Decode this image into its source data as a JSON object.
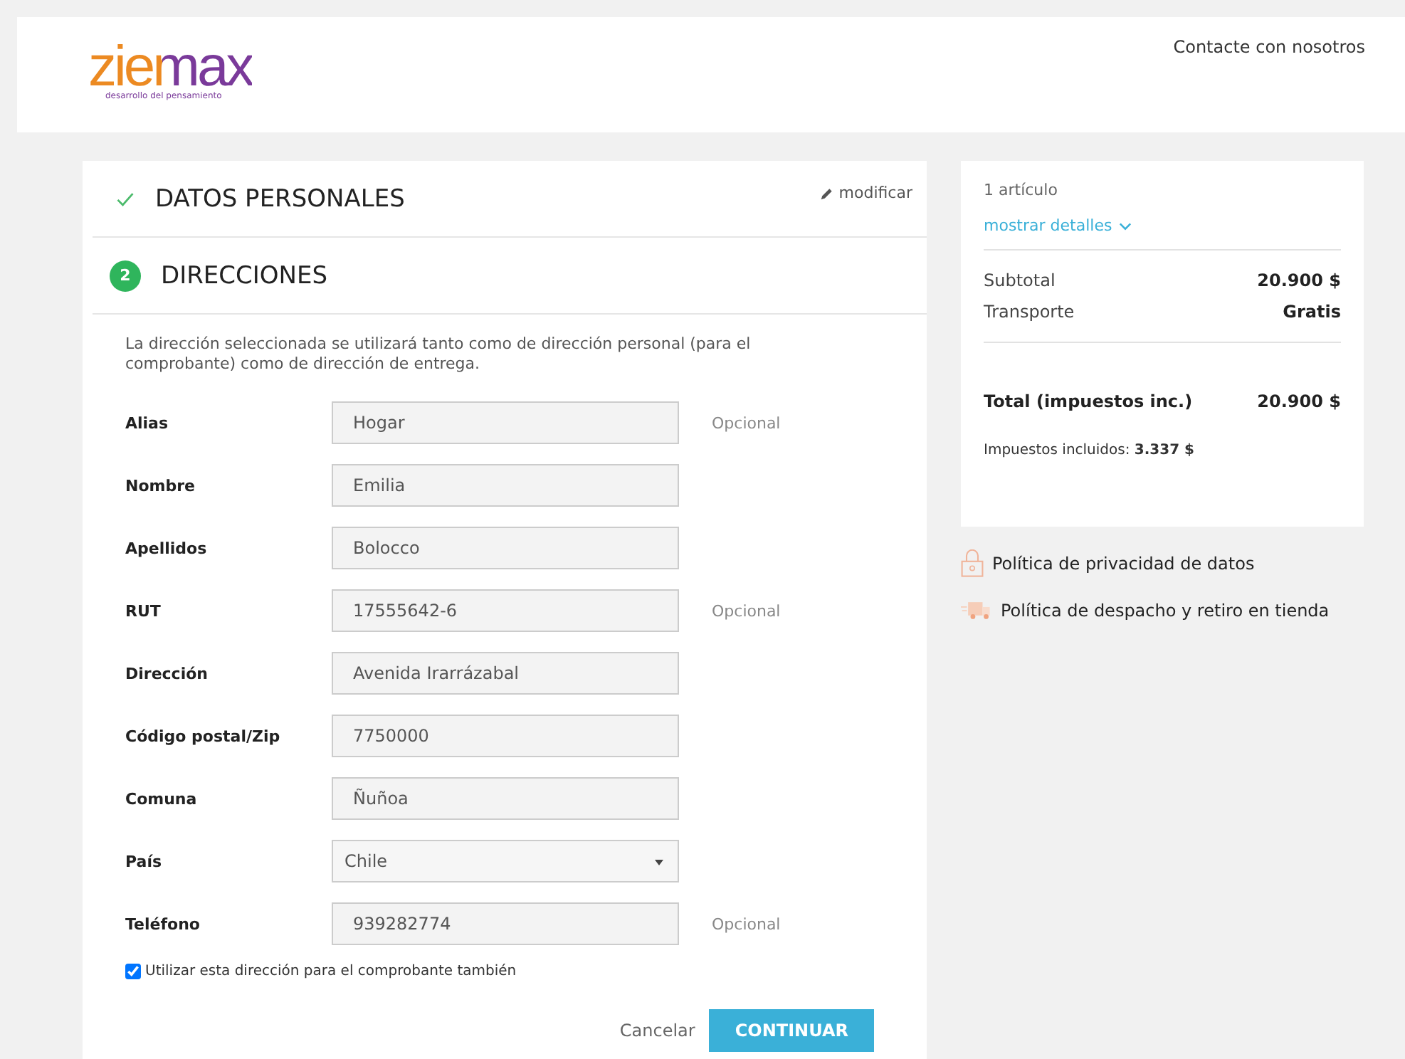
{
  "header": {
    "logo": {
      "wordmark": "ziemax",
      "tagline": "desarrollo del pensamiento"
    },
    "contact_link": "Contacte con nosotros"
  },
  "steps": [
    {
      "kind": "done",
      "title": "DATOS PERSONALES",
      "edit_link": "modificar"
    },
    {
      "kind": "current",
      "number": "2",
      "title": "DIRECCIONES"
    }
  ],
  "address_form": {
    "intro": "La dirección seleccionada se utilizará tanto como de dirección personal (para el comprobante) como de dirección de entrega.",
    "fields": [
      {
        "label": "Alias",
        "kind": "text",
        "value": "Hogar",
        "note": "Opcional"
      },
      {
        "label": "Nombre",
        "kind": "text",
        "value": "Emilia"
      },
      {
        "label": "Apellidos",
        "kind": "text",
        "value": "Bolocco"
      },
      {
        "label": "RUT",
        "kind": "text",
        "value": "17555642-6",
        "note": "Opcional"
      },
      {
        "label": "Dirección",
        "kind": "text",
        "value": "Avenida Irarrázabal"
      },
      {
        "label": "Código postal/Zip",
        "kind": "text",
        "value": "7750000"
      },
      {
        "label": "Comuna",
        "kind": "text",
        "value": "Ñuñoa"
      },
      {
        "label": "País",
        "kind": "select",
        "value": "Chile"
      },
      {
        "label": "Teléfono",
        "kind": "text",
        "value": "939282774",
        "note": "Opcional"
      }
    ],
    "same_address": {
      "label": "Utilizar esta dirección para el comprobante también",
      "checked": true
    },
    "buttons": {
      "cancel": "Cancelar",
      "continue": "CONTINUAR"
    }
  },
  "summary": {
    "item_count": "1 artículo",
    "details_link": "mostrar detalles",
    "lines": [
      {
        "label": "Subtotal",
        "value": "20.900 $"
      },
      {
        "label": "Transporte",
        "value": "Gratis"
      }
    ],
    "total": {
      "label": "Total (impuestos inc.)",
      "value": "20.900 $"
    },
    "taxes": "Impuestos incluidos: **3.337 $**"
  },
  "policies": [
    {
      "kind": "privacy",
      "text": "Política de privacidad de datos"
    },
    {
      "kind": "shipping",
      "text": "Política de despacho y retiro en tienda"
    }
  ]
}
